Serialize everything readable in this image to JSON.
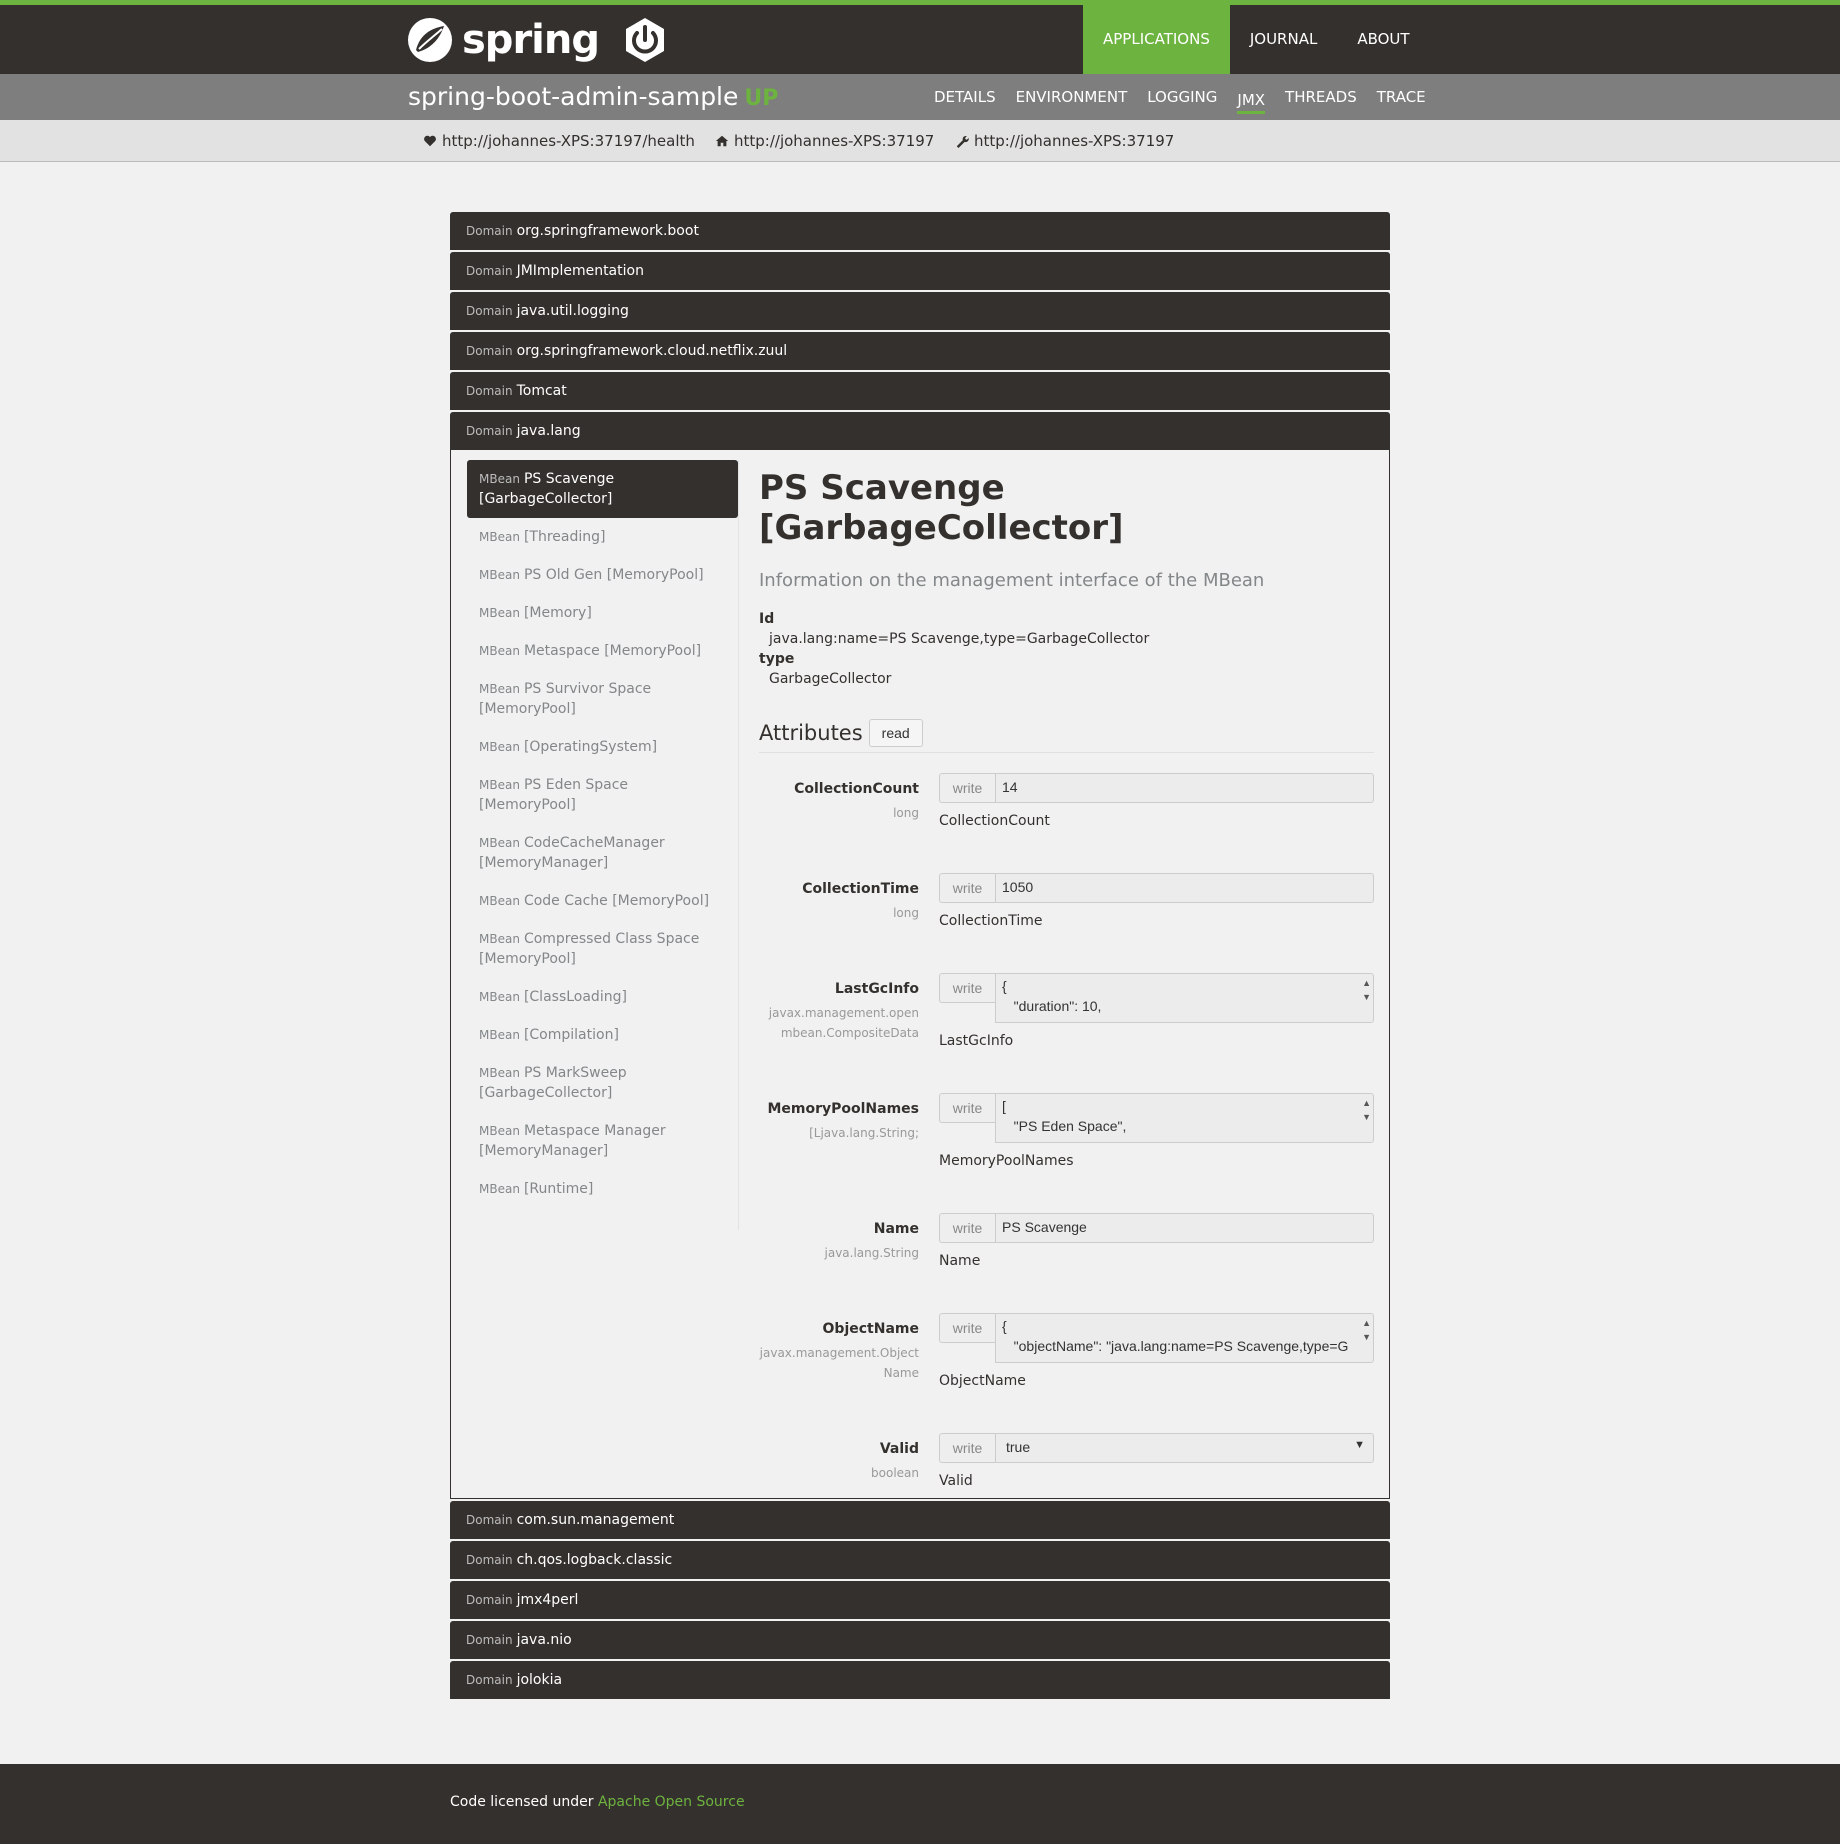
{
  "topnav": {
    "logo_text": "spring",
    "items": [
      "APPLICATIONS",
      "JOURNAL",
      "ABOUT"
    ]
  },
  "app": {
    "name": "spring-boot-admin-sample",
    "status": "UP",
    "tabs": [
      "DETAILS",
      "ENVIRONMENT",
      "LOGGING",
      "JMX",
      "THREADS",
      "TRACE"
    ]
  },
  "urls": {
    "health": "http://johannes-XPS:37197/health",
    "home": "http://johannes-XPS:37197",
    "management": "http://johannes-XPS:37197"
  },
  "domain_label": "Domain",
  "mbean_label": "MBean",
  "domains_before": [
    "org.springframework.boot",
    "JMImplementation",
    "java.util.logging",
    "org.springframework.cloud.netflix.zuul",
    "Tomcat"
  ],
  "open_domain": "java.lang",
  "domains_after": [
    "com.sun.management",
    "ch.qos.logback.classic",
    "jmx4perl",
    "java.nio",
    "jolokia"
  ],
  "mbeans": [
    "PS Scavenge [GarbageCollector]",
    "[Threading]",
    "PS Old Gen [MemoryPool]",
    "[Memory]",
    "Metaspace [MemoryPool]",
    "PS Survivor Space [MemoryPool]",
    "[OperatingSystem]",
    "PS Eden Space [MemoryPool]",
    "CodeCacheManager [MemoryManager]",
    "Code Cache [MemoryPool]",
    "Compressed Class Space [MemoryPool]",
    "[ClassLoading]",
    "[Compilation]",
    "PS MarkSweep [GarbageCollector]",
    "Metaspace Manager [MemoryManager]",
    "[Runtime]"
  ],
  "detail": {
    "title": "PS Scavenge [GarbageCollector]",
    "description": "Information on the management interface of the MBean",
    "id_label": "Id",
    "id_value": "java.lang:name=PS Scavenge,type=GarbageCollector",
    "type_label": "type",
    "type_value": "GarbageCollector",
    "attributes_title": "Attributes",
    "read_button": "read",
    "write_label": "write"
  },
  "attributes": [
    {
      "name": "CollectionCount",
      "type": "long",
      "value": "14",
      "help": "CollectionCount"
    },
    {
      "name": "CollectionTime",
      "type": "long",
      "value": "1050",
      "help": "CollectionTime"
    },
    {
      "name": "LastGcInfo",
      "type": "javax.management.openmbean.CompositeData",
      "value": "{\n   \"duration\": 10,",
      "help": "LastGcInfo"
    },
    {
      "name": "MemoryPoolNames",
      "type": "[Ljava.lang.String;",
      "value": "[\n   \"PS Eden Space\",",
      "help": "MemoryPoolNames"
    },
    {
      "name": "Name",
      "type": "java.lang.String",
      "value": "PS Scavenge",
      "help": "Name"
    },
    {
      "name": "ObjectName",
      "type": "javax.management.ObjectName",
      "value": "{\n   \"objectName\": \"java.lang:name=PS Scavenge,type=G",
      "help": "ObjectName"
    },
    {
      "name": "Valid",
      "type": "boolean",
      "value": "true",
      "help": "Valid"
    }
  ],
  "footer": {
    "text": "Code licensed under",
    "link": "Apache Open Source"
  },
  "colors": {
    "brand_green": "#6db33f",
    "dark": "#34302d"
  }
}
